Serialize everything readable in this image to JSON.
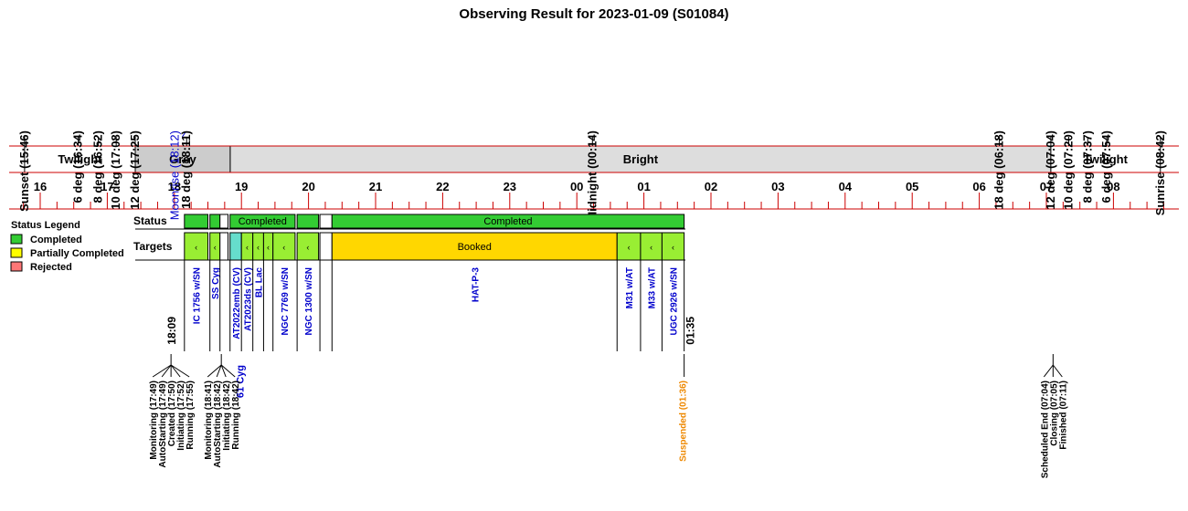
{
  "chart_data": {
    "type": "timeline",
    "title": "Observing Result for 2023-01-09 (S01084)",
    "hour_labels": [
      "16",
      "17",
      "18",
      "19",
      "20",
      "21",
      "22",
      "23",
      "00",
      "01",
      "02",
      "03",
      "04",
      "05",
      "06",
      "07",
      "08"
    ],
    "sky_events": [
      {
        "label": "Sunset (15:46)",
        "t": 15.767,
        "color": "#000000"
      },
      {
        "label": "6 deg (16:34)",
        "t": 16.567,
        "color": "#000000"
      },
      {
        "label": "8 deg (16:52)",
        "t": 16.867,
        "color": "#000000"
      },
      {
        "label": "10 deg (17:08)",
        "t": 17.133,
        "color": "#000000"
      },
      {
        "label": "12 deg (17:25)",
        "t": 17.417,
        "color": "#000000"
      },
      {
        "label": "Moonrise (18:12)",
        "t": 18.2,
        "color": "#0000cc"
      },
      {
        "label": "18 deg (18:11)",
        "t": 18.183,
        "color": "#000000"
      },
      {
        "label": "Midnight (00:14)",
        "t": 24.233,
        "color": "#000000"
      },
      {
        "label": "18 deg (06:18)",
        "t": 30.3,
        "color": "#000000"
      },
      {
        "label": "12 deg (07:04)",
        "t": 31.067,
        "color": "#000000"
      },
      {
        "label": "10 deg (07:20)",
        "t": 31.333,
        "color": "#000000"
      },
      {
        "label": "8 deg (07:37)",
        "t": 31.617,
        "color": "#000000"
      },
      {
        "label": "6 deg (07:54)",
        "t": 31.9,
        "color": "#000000"
      },
      {
        "label": "Sunrise (08:42)",
        "t": 32.7,
        "color": "#000000"
      }
    ],
    "sky_periods": [
      {
        "label": "Twilight",
        "start": 15.767,
        "end": 17.417,
        "color": "#ffffff"
      },
      {
        "label": "Grey",
        "start": 17.417,
        "end": 18.833,
        "color": "#cccccc"
      },
      {
        "label": "Bright",
        "start": 18.833,
        "end": 31.067,
        "color": "#dddddd"
      },
      {
        "label": "Twilight",
        "start": 31.067,
        "end": 32.7,
        "color": "#ffffff"
      }
    ],
    "legend": {
      "title": "Status Legend",
      "items": [
        {
          "label": "Completed",
          "color": "#33cc33"
        },
        {
          "label": "Partially Completed",
          "color": "#ffff00"
        },
        {
          "label": "Rejected",
          "color": "#ff7777"
        }
      ]
    },
    "row_labels": {
      "status": "Status",
      "targets": "Targets"
    },
    "status_blocks": [
      {
        "start": 18.15,
        "end": 18.5,
        "color": "#33cc33",
        "label": ""
      },
      {
        "start": 18.53,
        "end": 18.68,
        "color": "#33cc33",
        "label": ""
      },
      {
        "start": 18.68,
        "end": 18.8,
        "color": "#ffffff",
        "label": ""
      },
      {
        "start": 18.83,
        "end": 19.8,
        "color": "#33cc33",
        "label": "Completed"
      },
      {
        "start": 19.83,
        "end": 20.15,
        "color": "#33cc33",
        "label": ""
      },
      {
        "start": 20.17,
        "end": 20.35,
        "color": "#ffffff",
        "label": ""
      },
      {
        "start": 20.35,
        "end": 25.6,
        "color": "#33cc33",
        "label": "Completed"
      }
    ],
    "targets": [
      {
        "name": "IC 1756 w/SN",
        "start": 18.15,
        "end": 18.5,
        "color": "#99ee33",
        "mark": "‹",
        "name_color": "#0000cc"
      },
      {
        "name": "SS Cyg",
        "start": 18.53,
        "end": 18.68,
        "color": "#99ee33",
        "mark": "‹",
        "name_color": "#0000cc"
      },
      {
        "name": "",
        "start": 18.68,
        "end": 18.8,
        "color": "#ffffff",
        "mark": "",
        "name_color": "#0000cc"
      },
      {
        "name": "AT2022emb (CV)",
        "start": 18.83,
        "end": 19.0,
        "color": "#66ddcc",
        "mark": "",
        "name_color": "#0000cc"
      },
      {
        "name": "AT2023ds (CV)",
        "start": 19.0,
        "end": 19.17,
        "color": "#99ee33",
        "mark": "‹",
        "name_color": "#0000cc"
      },
      {
        "name": "BL Lac",
        "start": 19.17,
        "end": 19.33,
        "color": "#99ee33",
        "mark": "‹",
        "name_color": "#0000cc"
      },
      {
        "name": "",
        "start": 19.33,
        "end": 19.47,
        "color": "#99ee33",
        "mark": "‹",
        "name_color": "#0000cc"
      },
      {
        "name": "NGC 7769 w/SN",
        "start": 19.47,
        "end": 19.8,
        "color": "#99ee33",
        "mark": "‹",
        "name_color": "#0000cc"
      },
      {
        "name": "NGC 1300 w/SN",
        "start": 19.83,
        "end": 20.15,
        "color": "#99ee33",
        "mark": "‹",
        "name_color": "#0000cc"
      },
      {
        "name": "",
        "start": 20.17,
        "end": 20.35,
        "color": "#ffffff",
        "mark": "",
        "name_color": "#0000cc"
      },
      {
        "name": "HAT-P-3",
        "start": 20.35,
        "end": 24.6,
        "color": "#ffd700",
        "mark": "Booked",
        "name_color": "#0000cc"
      },
      {
        "name": "M31 w/AT",
        "start": 24.6,
        "end": 24.95,
        "color": "#99ee33",
        "mark": "‹",
        "name_color": "#0000cc"
      },
      {
        "name": "M33 w/AT",
        "start": 24.95,
        "end": 25.27,
        "color": "#99ee33",
        "mark": "‹",
        "name_color": "#0000cc"
      },
      {
        "name": "UGC 2926 w/SN",
        "start": 25.27,
        "end": 25.6,
        "color": "#99ee33",
        "mark": "‹",
        "name_color": "#0000cc"
      }
    ],
    "extra_target_labels": [
      {
        "name": "61 Cyg",
        "t": 18.98,
        "color": "#0000cc"
      }
    ],
    "time_marks": [
      {
        "label": "18:09",
        "t": 18.15
      },
      {
        "label": "01:35",
        "t": 25.583
      }
    ],
    "log_groups": [
      {
        "anchor": 17.95,
        "entries": [
          {
            "label": "Monitoring (17:49)",
            "color": "#000000"
          },
          {
            "label": "AutoStarting (17:49)",
            "color": "#000000"
          },
          {
            "label": "Created (17:50)",
            "color": "#000000"
          },
          {
            "label": "Initiating (17:52)",
            "color": "#000000"
          },
          {
            "label": "Running (17:55)",
            "color": "#000000"
          }
        ]
      },
      {
        "anchor": 18.7,
        "entries": [
          {
            "label": "Monitoring (18:41)",
            "color": "#000000"
          },
          {
            "label": "AutoStarting (18:42)",
            "color": "#000000"
          },
          {
            "label": "Initiating (18:42)",
            "color": "#000000"
          },
          {
            "label": "Running (18:42)",
            "color": "#000000"
          }
        ]
      },
      {
        "anchor": 25.6,
        "entries": [
          {
            "label": "Suspended (01:36)",
            "color": "#ee8800"
          }
        ]
      },
      {
        "anchor": 31.1,
        "entries": [
          {
            "label": "Scheduled End (07:04)",
            "color": "#000000"
          },
          {
            "label": "Closing (07:05)",
            "color": "#000000"
          },
          {
            "label": "Finished (07:11)",
            "color": "#000000"
          }
        ]
      }
    ]
  }
}
